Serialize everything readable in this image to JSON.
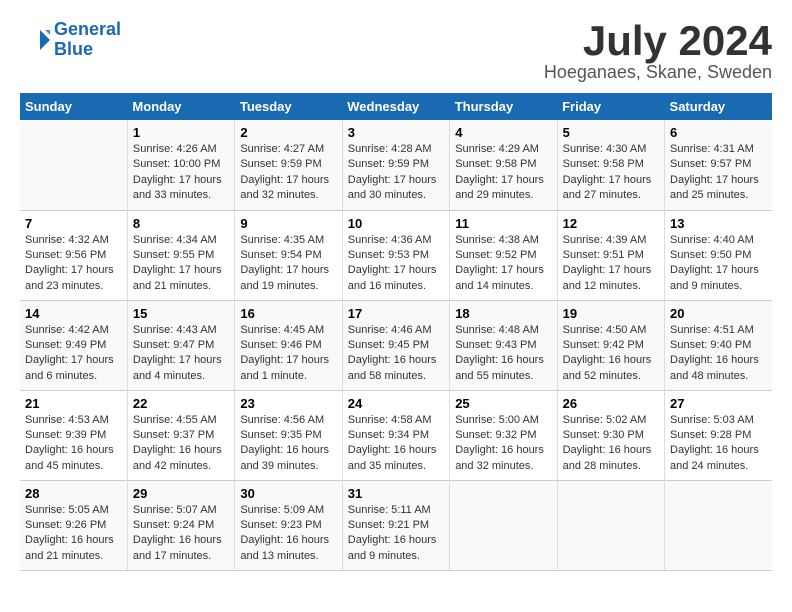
{
  "header": {
    "logo_line1": "General",
    "logo_line2": "Blue",
    "month_year": "July 2024",
    "location": "Hoeganaes, Skane, Sweden"
  },
  "days_of_week": [
    "Sunday",
    "Monday",
    "Tuesday",
    "Wednesday",
    "Thursday",
    "Friday",
    "Saturday"
  ],
  "weeks": [
    [
      {
        "day": "",
        "info": ""
      },
      {
        "day": "1",
        "info": "Sunrise: 4:26 AM\nSunset: 10:00 PM\nDaylight: 17 hours\nand 33 minutes."
      },
      {
        "day": "2",
        "info": "Sunrise: 4:27 AM\nSunset: 9:59 PM\nDaylight: 17 hours\nand 32 minutes."
      },
      {
        "day": "3",
        "info": "Sunrise: 4:28 AM\nSunset: 9:59 PM\nDaylight: 17 hours\nand 30 minutes."
      },
      {
        "day": "4",
        "info": "Sunrise: 4:29 AM\nSunset: 9:58 PM\nDaylight: 17 hours\nand 29 minutes."
      },
      {
        "day": "5",
        "info": "Sunrise: 4:30 AM\nSunset: 9:58 PM\nDaylight: 17 hours\nand 27 minutes."
      },
      {
        "day": "6",
        "info": "Sunrise: 4:31 AM\nSunset: 9:57 PM\nDaylight: 17 hours\nand 25 minutes."
      }
    ],
    [
      {
        "day": "7",
        "info": "Sunrise: 4:32 AM\nSunset: 9:56 PM\nDaylight: 17 hours\nand 23 minutes."
      },
      {
        "day": "8",
        "info": "Sunrise: 4:34 AM\nSunset: 9:55 PM\nDaylight: 17 hours\nand 21 minutes."
      },
      {
        "day": "9",
        "info": "Sunrise: 4:35 AM\nSunset: 9:54 PM\nDaylight: 17 hours\nand 19 minutes."
      },
      {
        "day": "10",
        "info": "Sunrise: 4:36 AM\nSunset: 9:53 PM\nDaylight: 17 hours\nand 16 minutes."
      },
      {
        "day": "11",
        "info": "Sunrise: 4:38 AM\nSunset: 9:52 PM\nDaylight: 17 hours\nand 14 minutes."
      },
      {
        "day": "12",
        "info": "Sunrise: 4:39 AM\nSunset: 9:51 PM\nDaylight: 17 hours\nand 12 minutes."
      },
      {
        "day": "13",
        "info": "Sunrise: 4:40 AM\nSunset: 9:50 PM\nDaylight: 17 hours\nand 9 minutes."
      }
    ],
    [
      {
        "day": "14",
        "info": "Sunrise: 4:42 AM\nSunset: 9:49 PM\nDaylight: 17 hours\nand 6 minutes."
      },
      {
        "day": "15",
        "info": "Sunrise: 4:43 AM\nSunset: 9:47 PM\nDaylight: 17 hours\nand 4 minutes."
      },
      {
        "day": "16",
        "info": "Sunrise: 4:45 AM\nSunset: 9:46 PM\nDaylight: 17 hours\nand 1 minute."
      },
      {
        "day": "17",
        "info": "Sunrise: 4:46 AM\nSunset: 9:45 PM\nDaylight: 16 hours\nand 58 minutes."
      },
      {
        "day": "18",
        "info": "Sunrise: 4:48 AM\nSunset: 9:43 PM\nDaylight: 16 hours\nand 55 minutes."
      },
      {
        "day": "19",
        "info": "Sunrise: 4:50 AM\nSunset: 9:42 PM\nDaylight: 16 hours\nand 52 minutes."
      },
      {
        "day": "20",
        "info": "Sunrise: 4:51 AM\nSunset: 9:40 PM\nDaylight: 16 hours\nand 48 minutes."
      }
    ],
    [
      {
        "day": "21",
        "info": "Sunrise: 4:53 AM\nSunset: 9:39 PM\nDaylight: 16 hours\nand 45 minutes."
      },
      {
        "day": "22",
        "info": "Sunrise: 4:55 AM\nSunset: 9:37 PM\nDaylight: 16 hours\nand 42 minutes."
      },
      {
        "day": "23",
        "info": "Sunrise: 4:56 AM\nSunset: 9:35 PM\nDaylight: 16 hours\nand 39 minutes."
      },
      {
        "day": "24",
        "info": "Sunrise: 4:58 AM\nSunset: 9:34 PM\nDaylight: 16 hours\nand 35 minutes."
      },
      {
        "day": "25",
        "info": "Sunrise: 5:00 AM\nSunset: 9:32 PM\nDaylight: 16 hours\nand 32 minutes."
      },
      {
        "day": "26",
        "info": "Sunrise: 5:02 AM\nSunset: 9:30 PM\nDaylight: 16 hours\nand 28 minutes."
      },
      {
        "day": "27",
        "info": "Sunrise: 5:03 AM\nSunset: 9:28 PM\nDaylight: 16 hours\nand 24 minutes."
      }
    ],
    [
      {
        "day": "28",
        "info": "Sunrise: 5:05 AM\nSunset: 9:26 PM\nDaylight: 16 hours\nand 21 minutes."
      },
      {
        "day": "29",
        "info": "Sunrise: 5:07 AM\nSunset: 9:24 PM\nDaylight: 16 hours\nand 17 minutes."
      },
      {
        "day": "30",
        "info": "Sunrise: 5:09 AM\nSunset: 9:23 PM\nDaylight: 16 hours\nand 13 minutes."
      },
      {
        "day": "31",
        "info": "Sunrise: 5:11 AM\nSunset: 9:21 PM\nDaylight: 16 hours\nand 9 minutes."
      },
      {
        "day": "",
        "info": ""
      },
      {
        "day": "",
        "info": ""
      },
      {
        "day": "",
        "info": ""
      }
    ]
  ]
}
